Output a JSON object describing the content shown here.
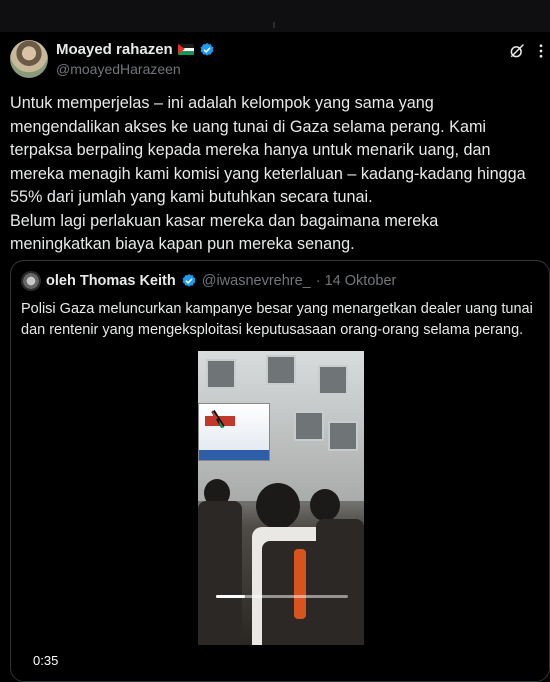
{
  "author": {
    "display_name": "Moayed rahazen",
    "handle": "@moayedHarazeen",
    "flag_icon": "palestine-flag-icon",
    "verified_color": "#1d9bf0"
  },
  "tweet": {
    "text": "Untuk memperjelas – ini adalah kelompok yang sama yang mengendalikan akses ke uang tunai di Gaza selama perang. Kami terpaksa berpaling kepada mereka hanya untuk menarik uang, dan mereka menagih kami komisi yang keterlaluan – kadang-kadang hingga 55% dari jumlah yang kami butuhkan secara tunai.\nBelum lagi perlakuan kasar mereka dan bagaimana mereka meningkatkan biaya kapan pun mereka senang."
  },
  "quote": {
    "display_name": "oleh Thomas Keith",
    "handle": "@iwasnevrehre_",
    "date": "· 14 Oktober",
    "text": "Polisi Gaza meluncurkan kampanye besar yang menargetkan dealer uang tunai dan rentenir yang mengeksploitasi keputusasaan orang-orang selama perang.",
    "video": {
      "timestamp": "0:35",
      "progress_fraction": 0.22
    }
  },
  "icons": {
    "grok": "grok-icon",
    "more": "more-vertical-icon"
  }
}
